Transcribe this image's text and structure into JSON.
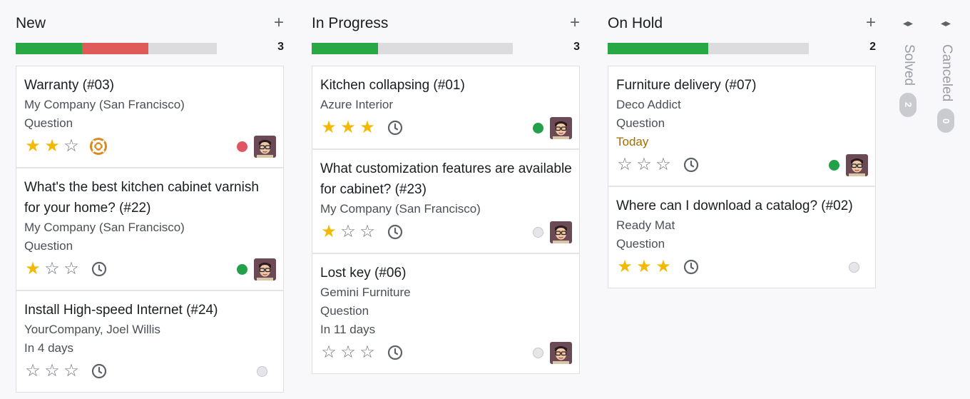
{
  "colors": {
    "green": "#28a745",
    "red": "#e05a5a",
    "grey": "#dcdcdf",
    "star_on": "#f3b800",
    "today": "#a86c00"
  },
  "icons": {
    "add": "plus-icon",
    "clock": "clock-icon",
    "lifebuoy": "lifebuoy-icon",
    "fold": "expand-arrows-icon"
  },
  "columns": [
    {
      "title": "New",
      "count": "3",
      "add_label": "+",
      "progress": {
        "green": 0.33,
        "red": 0.33
      },
      "cards": [
        {
          "title": "Warranty (#03)",
          "lines": [
            "My Company (San Francisco)",
            "Question"
          ],
          "rating": 2,
          "activity": "lifebuoy",
          "status": "red"
        },
        {
          "title": "What's the best kitchen cabinet varnish for your home? (#22)",
          "lines": [
            "My Company (San Francisco)",
            "Question"
          ],
          "rating": 1,
          "activity": "clock",
          "status": "green"
        },
        {
          "title": "Install High-speed Internet (#24)",
          "lines": [
            "YourCompany, Joel Willis",
            "In 4 days"
          ],
          "rating": 0,
          "activity": "clock",
          "status": "grey"
        }
      ]
    },
    {
      "title": "In Progress",
      "count": "3",
      "add_label": "+",
      "progress": {
        "green": 0.33,
        "red": 0
      },
      "cards": [
        {
          "title": "Kitchen collapsing (#01)",
          "lines": [
            "Azure Interior"
          ],
          "rating": 3,
          "activity": "clock",
          "status": "green"
        },
        {
          "title": "What customization features are available for cabinet? (#23)",
          "lines": [
            "My Company (San Francisco)"
          ],
          "rating": 1,
          "activity": "clock",
          "status": "grey-avatar"
        },
        {
          "title": "Lost key (#06)",
          "lines": [
            "Gemini Furniture",
            "Question",
            "In 11 days"
          ],
          "rating": 0,
          "activity": "clock",
          "status": "grey-avatar"
        }
      ]
    },
    {
      "title": "On Hold",
      "count": "2",
      "add_label": "+",
      "progress": {
        "green": 0.5,
        "red": 0
      },
      "cards": [
        {
          "title": "Furniture delivery (#07)",
          "lines": [
            "Deco Addict",
            "Question"
          ],
          "today": "Today",
          "rating": 0,
          "activity": "clock",
          "status": "green"
        },
        {
          "title": "Where can I download a catalog? (#02)",
          "lines": [
            "Ready Mat",
            "Question"
          ],
          "rating": 3,
          "activity": "clock",
          "status": "grey"
        }
      ]
    }
  ],
  "folded": [
    {
      "label": "Solved",
      "count": "2",
      "toggle": "◂▸"
    },
    {
      "label": "Canceled",
      "count": "0",
      "toggle": "◂▸"
    }
  ]
}
